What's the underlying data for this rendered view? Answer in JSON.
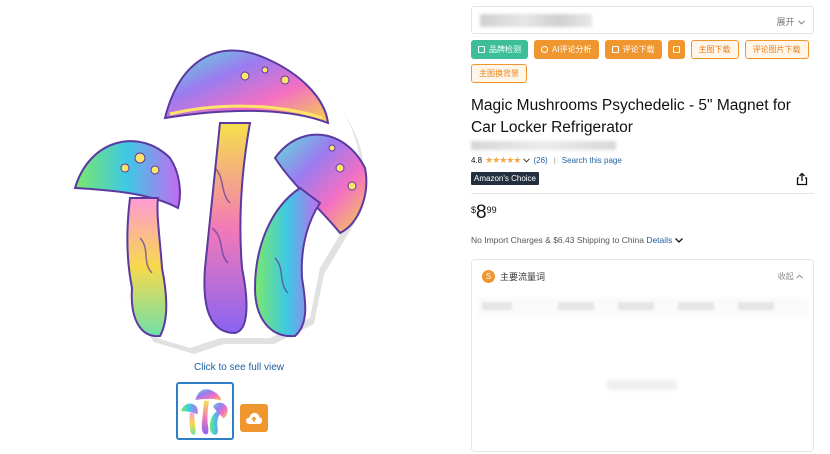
{
  "gallery": {
    "click_full_view": "Click to see full view"
  },
  "topbar": {
    "expand_label": "展开"
  },
  "tools": {
    "row1": [
      {
        "label": "品牌检测",
        "style": "solid-green"
      },
      {
        "label": "AI评论分析",
        "style": "solid-orange"
      },
      {
        "label": "评论下载",
        "style": "solid-orange"
      },
      {
        "label": "",
        "style": "solid-orange"
      },
      {
        "label": "主图下载",
        "style": "outline"
      },
      {
        "label": "评论图片下载",
        "style": "outline"
      }
    ],
    "row2": [
      {
        "label": "主图换背景",
        "style": "outline"
      }
    ]
  },
  "product": {
    "title": "Magic Mushrooms Psychedelic - 5\" Magnet for Car Locker Refrigerator",
    "rating": "4.8",
    "review_count": "(26)",
    "search_link": "Search this page",
    "badge": "Amazon's Choice",
    "price_symbol": "$",
    "price_whole": "8",
    "price_fraction": "99",
    "shipping_text": "No Import Charges & $6.43 Shipping to China",
    "details_link": "Details"
  },
  "panel": {
    "title": "主要流量词",
    "collapse_label": "收起"
  },
  "colors": {
    "accent_orange": "#f0962f",
    "accent_green": "#3cbf99",
    "link_blue": "#2162a1",
    "badge_bg": "#232f3e"
  }
}
